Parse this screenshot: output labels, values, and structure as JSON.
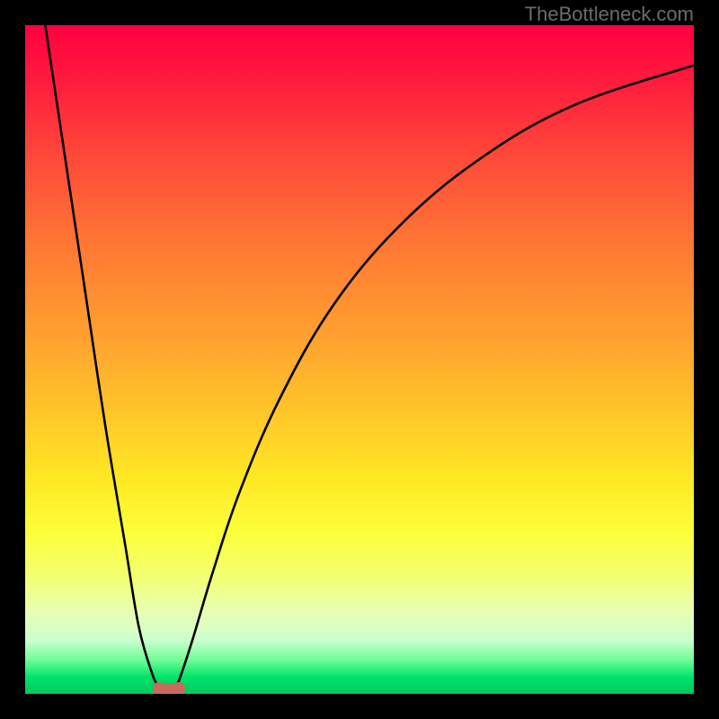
{
  "watermark": "TheBottleneck.com",
  "chart_data": {
    "type": "line",
    "title": "",
    "xlabel": "",
    "ylabel": "",
    "xlim": [
      0,
      100
    ],
    "ylim": [
      0,
      100
    ],
    "background_gradient_stops": [
      {
        "pos": 0,
        "color": "#ff0040"
      },
      {
        "pos": 50,
        "color": "#ffc629"
      },
      {
        "pos": 80,
        "color": "#fcff3a"
      },
      {
        "pos": 100,
        "color": "#00c85f"
      }
    ],
    "series": [
      {
        "name": "left-branch",
        "x": [
          3,
          6,
          9,
          12,
          15,
          17,
          19,
          20,
          20.5
        ],
        "y": [
          100,
          80,
          60,
          40,
          22,
          10,
          3,
          1,
          0
        ]
      },
      {
        "name": "right-branch",
        "x": [
          22,
          23,
          25,
          28,
          32,
          38,
          46,
          56,
          68,
          82,
          100
        ],
        "y": [
          0,
          2,
          8,
          18,
          30,
          44,
          58,
          70,
          80,
          88,
          94
        ]
      }
    ],
    "markers": [
      {
        "name": "min-left",
        "x": 20,
        "y": 0,
        "color": "#c96a5e",
        "r": 7
      },
      {
        "name": "min-right",
        "x": 23,
        "y": 0,
        "color": "#c96a5e",
        "r": 7
      }
    ],
    "trough_connector": {
      "x0": 20,
      "x1": 23,
      "y": 0,
      "color": "#c96a5e",
      "w": 12
    }
  }
}
